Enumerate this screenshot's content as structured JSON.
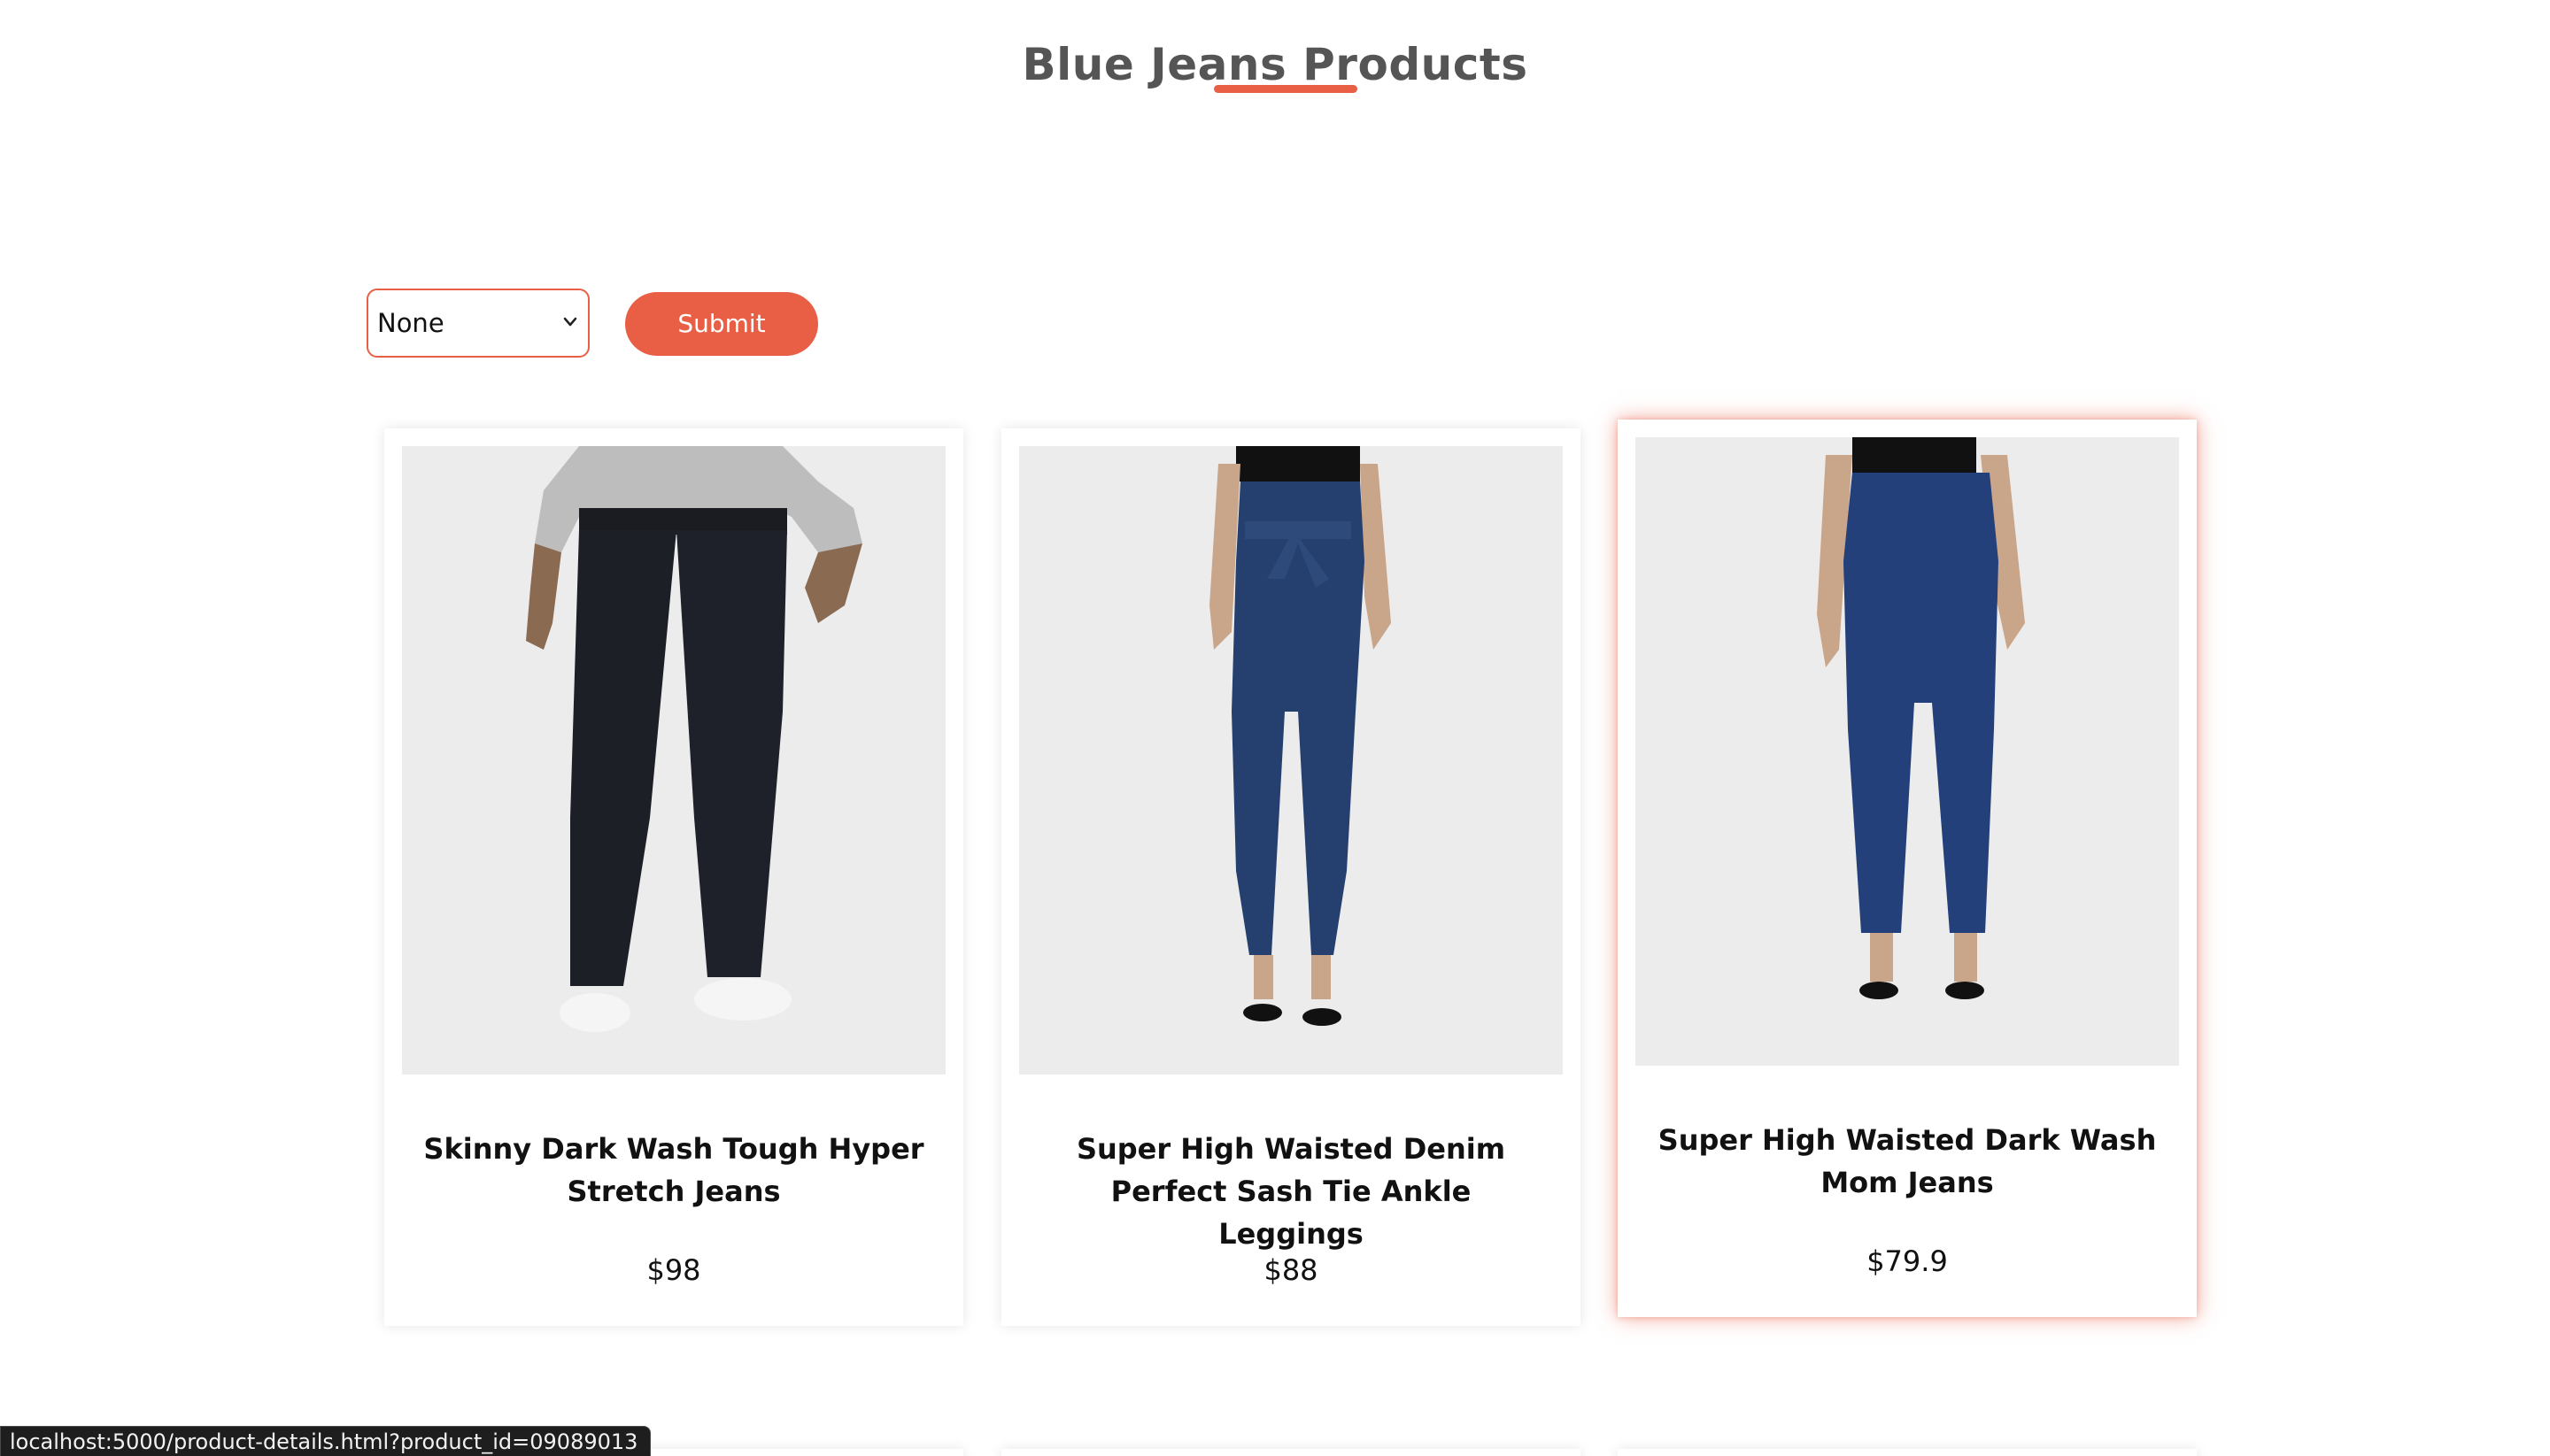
{
  "page": {
    "title": "Blue Jeans Products"
  },
  "filter": {
    "selected_value": "None",
    "submit_label": "Submit"
  },
  "products": [
    {
      "name": "Skinny Dark Wash Tough Hyper Stretch Jeans",
      "price": "$98",
      "image_icon": "mens-dark-jeans-photo"
    },
    {
      "name": "Super High Waisted Denim Perfect Sash Tie Ankle Leggings",
      "price": "$88",
      "image_icon": "womens-sash-tie-jeans-photo"
    },
    {
      "name": "Super High Waisted Dark Wash Mom Jeans",
      "price": "$79.9",
      "image_icon": "womens-mom-jeans-photo",
      "highlighted": true
    }
  ],
  "status_bar": {
    "url": "localhost:5000/product-details.html?product_id=09089013"
  },
  "colors": {
    "accent": "#e85f45",
    "title_text": "#555555",
    "body_text": "#111111",
    "image_background": "#ececec"
  }
}
